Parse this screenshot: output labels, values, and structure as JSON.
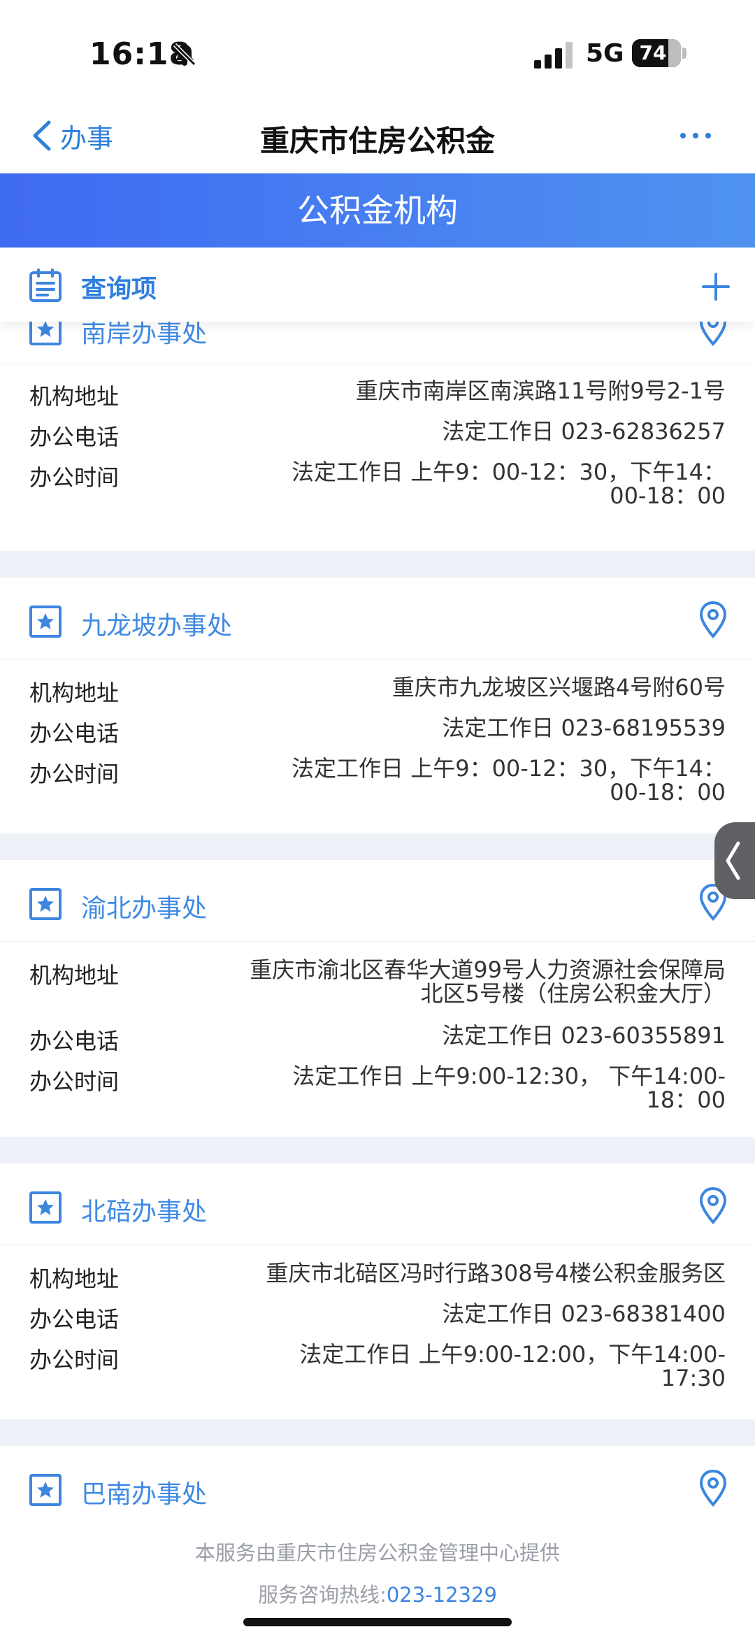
{
  "status_bar": {
    "time": "16:18",
    "network": "5G",
    "battery": "74",
    "battery_level_percent": 74
  },
  "nav": {
    "back_label": "办事",
    "title": "重庆市住房公积金"
  },
  "banner": {
    "title": "公积金机构"
  },
  "query": {
    "title": "查询项"
  },
  "labels": {
    "address": "机构地址",
    "phone": "办公电话",
    "hours": "办公时间"
  },
  "offices": [
    {
      "name": "南岸办事处",
      "address": "重庆市南岸区南滨路11号附9号2-1号",
      "phone": "法定工作日 023-62836257",
      "hours": "法定工作日 上午9：00-12：30，下午14：00-18：00"
    },
    {
      "name": "九龙坡办事处",
      "address": "重庆市九龙坡区兴堰路4号附60号",
      "phone": "法定工作日 023-68195539",
      "hours": "法定工作日 上午9：00-12：30，下午14：00-18：00"
    },
    {
      "name": "渝北办事处",
      "address": "重庆市渝北区春华大道99号人力资源社会保障局北区5号楼（住房公积金大厅）",
      "phone": "法定工作日 023-60355891",
      "hours": "法定工作日 上午9:00-12:30， 下午14:00-18：00"
    },
    {
      "name": "北碚办事处",
      "address": "重庆市北碚区冯时行路308号4楼公积金服务区",
      "phone": "法定工作日 023-68381400",
      "hours": "法定工作日 上午9:00-12:00，下午14:00-17:30"
    },
    {
      "name": "巴南办事处"
    }
  ],
  "footer": {
    "provider": "本服务由重庆市住房公积金管理中心提供",
    "hotline_label": "服务咨询热线:",
    "hotline": "023-12329"
  },
  "colors": {
    "accent": "#3f8ae3",
    "banner_start": "#3f6af2",
    "banner_end": "#4f93f0",
    "section_gap": "#eef1f7"
  }
}
